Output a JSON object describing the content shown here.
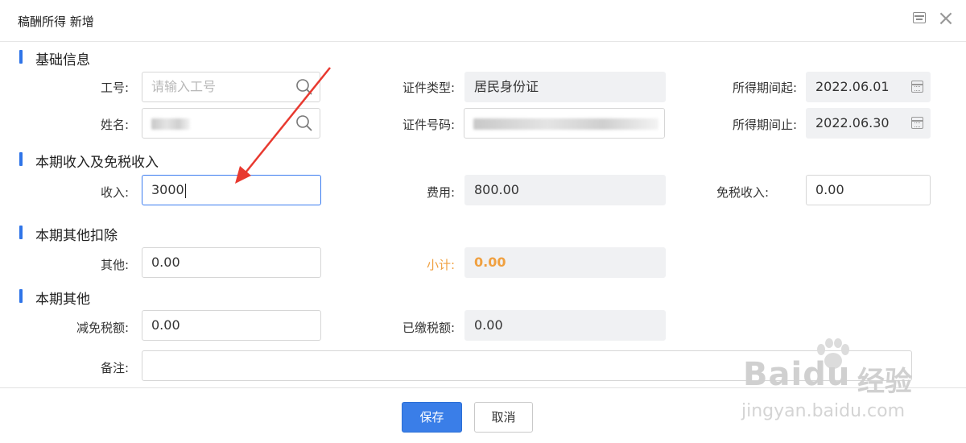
{
  "dialog": {
    "title": "稿酬所得 新增"
  },
  "sections": {
    "basic": "基础信息",
    "income": "本期收入及免税收入",
    "other_deduct": "本期其他扣除",
    "other": "本期其他"
  },
  "basic": {
    "employee_no": {
      "label": "工号:",
      "placeholder": "请输入工号"
    },
    "name": {
      "label": "姓名:"
    },
    "id_type": {
      "label": "证件类型:",
      "value": "居民身份证"
    },
    "id_number": {
      "label": "证件号码:"
    },
    "period_start": {
      "label": "所得期间起:",
      "value": "2022.06.01"
    },
    "period_end": {
      "label": "所得期间止:",
      "value": "2022.06.30"
    }
  },
  "income": {
    "income": {
      "label": "收入:",
      "value": "3000"
    },
    "expense": {
      "label": "费用:",
      "value": "800.00"
    },
    "tax_free": {
      "label": "免税收入:",
      "value": "0.00"
    }
  },
  "deduct": {
    "other": {
      "label": "其他:",
      "value": "0.00"
    },
    "subtotal": {
      "label": "小计:",
      "value": "0.00"
    }
  },
  "other": {
    "tax_reduction": {
      "label": "减免税额:",
      "value": "0.00"
    },
    "tax_paid": {
      "label": "已缴税额:",
      "value": "0.00"
    },
    "remark": {
      "label": "备注:",
      "value": ""
    }
  },
  "buttons": {
    "save": "保存",
    "cancel": "取消"
  },
  "watermark": {
    "logo": "Baidu",
    "cn": "经验",
    "url": "jingyan.baidu.com"
  },
  "colors": {
    "accent": "#3a7ee8",
    "subtotal": "#f0a040",
    "arrow": "#e8392f"
  }
}
